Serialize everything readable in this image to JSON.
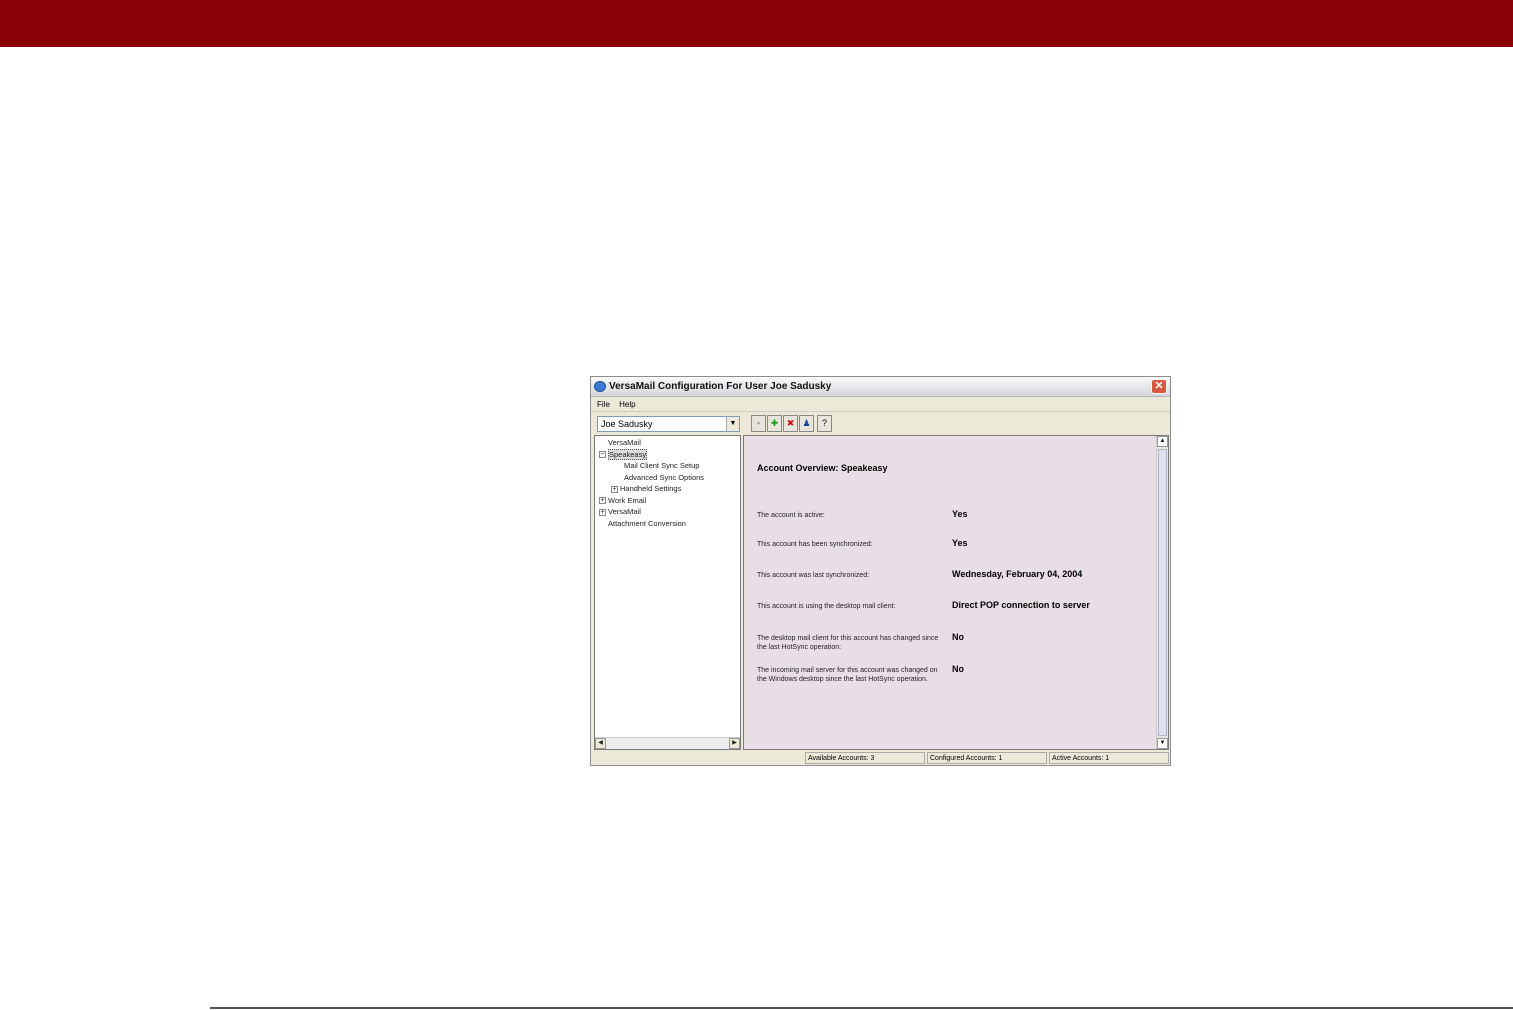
{
  "window": {
    "title": "VersaMail Configuration For User Joe Sadusky",
    "close_label": "✕"
  },
  "menu": [
    "File",
    "Help"
  ],
  "user_select": {
    "value": "Joe Sadusky"
  },
  "toolbar": [
    "save",
    "add-account",
    "delete-account",
    "user-settings",
    "help"
  ],
  "tree": [
    {
      "label": "VersaMail",
      "level": 0,
      "expander": ""
    },
    {
      "label": "Speakeasy",
      "level": 0,
      "expander": "−",
      "selected": true
    },
    {
      "label": "Mail Client Sync Setup",
      "level": 1,
      "expander": ""
    },
    {
      "label": "Advanced Sync Options",
      "level": 1,
      "expander": ""
    },
    {
      "label": "Handheld Settings",
      "level": 1,
      "expander": "+"
    },
    {
      "label": "Work Email",
      "level": 0,
      "expander": "+"
    },
    {
      "label": "VersaMail",
      "level": 0,
      "expander": "+"
    },
    {
      "label": "Attachment Conversion",
      "level": 0,
      "expander": ""
    }
  ],
  "content": {
    "heading": "Account Overview: Speakeasy",
    "rows": [
      {
        "label": "The account is active:",
        "value": "Yes"
      },
      {
        "label": "This account has been synchronized:",
        "value": "Yes"
      },
      {
        "label": "This account was last synchronized:",
        "value": "Wednesday, February 04, 2004"
      },
      {
        "label": "This account is using the desktop mail client:",
        "value": "Direct POP connection to server"
      },
      {
        "label": "The desktop mail client for this account has changed since the last HotSync operation:",
        "value": "No"
      },
      {
        "label": "The incoming mail server for this account was changed on the Windows desktop since the last HotSync operation.",
        "value": "No"
      }
    ]
  },
  "status": {
    "available": "Available Accounts: 3",
    "configured": "Configured Accounts: 1",
    "active": "Active Accounts: 1"
  }
}
